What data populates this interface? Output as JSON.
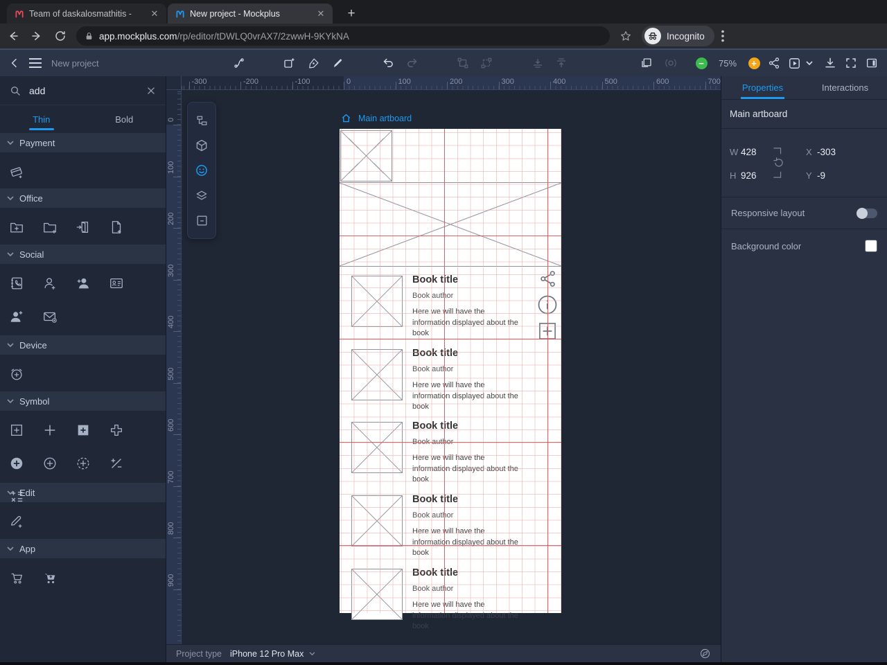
{
  "browser": {
    "tab1_title": "Team of daskalosmathitis -",
    "tab2_title": "New project - Mockplus",
    "url_host": "app.mockplus.com",
    "url_path": "/rp/editor/tDWLQ0vrAX7/2zwwH-9KYkNA",
    "incognito_label": "Incognito",
    "icons": [
      "back-icon",
      "forward-icon",
      "reload-icon",
      "lock-icon",
      "star-icon",
      "incognito-icon",
      "kebab-menu-icon",
      "close-icon",
      "new-tab-icon",
      "mockplus-favicon-red",
      "mockplus-favicon-blue"
    ]
  },
  "toolbar": {
    "project_name": "New project",
    "zoom_level": "75%",
    "icons": [
      "back-icon",
      "menu-icon",
      "connector-icon",
      "new-artboard-icon",
      "pen-icon",
      "pencil-icon",
      "undo-icon",
      "redo-icon",
      "group-icon",
      "ungroup-icon",
      "distribute-down-icon",
      "distribute-up-icon",
      "duplicate-icon",
      "target-icon",
      "zoom-out-icon",
      "zoom-in-icon",
      "share-icon",
      "preview-icon",
      "download-icon",
      "fullscreen-icon",
      "panel-toggle-icon"
    ],
    "zoom_out_color": "#3dba4e",
    "zoom_in_color": "#f2a71b"
  },
  "library": {
    "search_value": "add",
    "tabs": [
      {
        "label": "Thin"
      },
      {
        "label": "Bold"
      }
    ],
    "sections": [
      {
        "label": "Payment",
        "icons": [
          "card-add-icon"
        ]
      },
      {
        "label": "Office",
        "icons": [
          "folder-add-icon",
          "folder-add-alt-icon",
          "door-enter-icon",
          "file-add-icon"
        ]
      },
      {
        "label": "Social",
        "icons": [
          "contacts-book-icon",
          "person-add-outline-icon",
          "person-add-filled-icon",
          "address-card-icon",
          "person-plus-filled-icon",
          "mail-add-icon"
        ]
      },
      {
        "label": "Device",
        "icons": [
          "alarm-add-icon"
        ]
      },
      {
        "label": "Symbol",
        "icons": [
          "plus-square-outline-icon",
          "plus-icon",
          "plus-square-filled-icon",
          "plus-outline-icon",
          "plus-circle-filled-icon",
          "plus-circle-outline-icon",
          "plus-circle-dashed-icon",
          "plus-minus-icon",
          "math-symbols-icon"
        ]
      },
      {
        "label": "Edit",
        "icons": [
          "pencil-add-icon"
        ]
      },
      {
        "label": "App",
        "icons": [
          "cart-outline-icon",
          "cart-filled-icon"
        ]
      }
    ]
  },
  "tool_panel": {
    "icons": [
      "structure-icon",
      "component-cube-icon",
      "icons-library-smiley-icon",
      "layers-icon",
      "frame-icon"
    ],
    "active": "icons-library-smiley-icon"
  },
  "canvas": {
    "h_ruler_labels": [
      "-300",
      "-200",
      "-100",
      "0",
      "100",
      "200",
      "300",
      "400",
      "500",
      "600",
      "700"
    ],
    "v_ruler_labels": [
      "0",
      "100",
      "200",
      "300",
      "400",
      "500",
      "600",
      "700",
      "800",
      "900"
    ],
    "artboard": {
      "label": "Main artboard",
      "item_icons": [
        "share-icon",
        "info-icon",
        "add-icon"
      ],
      "items": [
        {
          "title": "Book title",
          "author": "Book author",
          "desc_lines": [
            "Here we will have the",
            "information displayed about the",
            "book"
          ]
        },
        {
          "title": "Book title",
          "author": "Book author",
          "desc_lines": [
            "Here we will have the",
            "information displayed about the",
            "book"
          ]
        },
        {
          "title": "Book title",
          "author": "Book author",
          "desc_lines": [
            "Here we will have the",
            "information displayed about the",
            "book"
          ]
        },
        {
          "title": "Book title",
          "author": "Book author",
          "desc_lines": [
            "Here we will have the",
            "information displayed about the",
            "book"
          ]
        },
        {
          "title": "Book title",
          "author": "Book author",
          "desc_lines": [
            "Here we will have the",
            "information displayed about the",
            "book"
          ]
        }
      ]
    }
  },
  "properties": {
    "tabs": [
      {
        "label": "Properties"
      },
      {
        "label": "Interactions"
      }
    ],
    "selection_name": "Main artboard",
    "fields": {
      "w_label": "W",
      "w": "428",
      "h_label": "H",
      "h": "926",
      "x_label": "X",
      "x": "-303",
      "y_label": "Y",
      "y": "-9"
    },
    "responsive_label": "Responsive layout",
    "responsive_on": false,
    "background_label": "Background color",
    "background_value": "#ffffff"
  },
  "bottom_bar": {
    "label": "Project type",
    "value": "iPhone 12 Pro Max"
  },
  "colors": {
    "accent": "#1e9bf0",
    "grid_minor": "#ebA0a0",
    "grid_major": "#d65050",
    "artboard_bg": "#ffffff"
  }
}
